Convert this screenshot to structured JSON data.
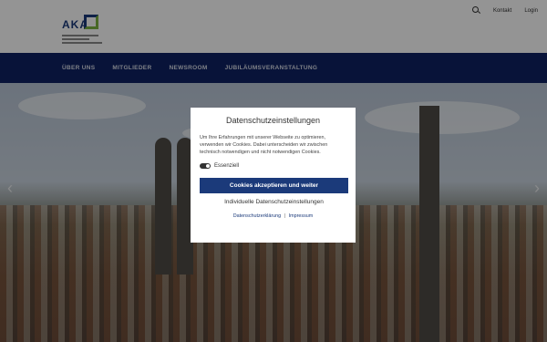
{
  "header": {
    "logo_text": "AKA",
    "topnav": {
      "search_icon": "search-icon",
      "contact": "Kontakt",
      "login": "Login"
    }
  },
  "mainnav": {
    "items": [
      "ÜBER UNS",
      "MITGLIEDER",
      "NEWSROOM",
      "JUBILÄUMSVERANSTALTUNG"
    ]
  },
  "hero": {
    "prev_arrow": "‹",
    "next_arrow": "›"
  },
  "cookie_dialog": {
    "title": "Datenschutzeinstellungen",
    "text": "Um Ihre Erfahrungen mit unserer Webseite zu optimieren, verwenden wir Cookies. Dabei unterscheiden wir zwischen technisch notwendigen und nicht notwendigen Cookies.",
    "essential_label": "Essenziell",
    "essential_enabled": true,
    "accept_button": "Cookies akzeptieren und weiter",
    "settings_link": "Individuelle Datenschutzeinstellungen",
    "privacy_link": "Datenschutzerklärung",
    "separator": "|",
    "imprint_link": "Impressum"
  },
  "colors": {
    "navy": "#0f2163",
    "accent": "#1b3a7a",
    "green": "#7cb342"
  }
}
